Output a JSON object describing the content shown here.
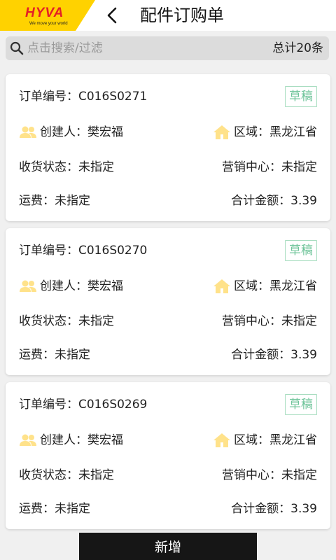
{
  "header": {
    "logo_text": "HYVA",
    "logo_tagline": "We move your world",
    "title": "配件订购单"
  },
  "search": {
    "placeholder": "点击搜索/过滤",
    "total": "总计20条"
  },
  "orders": [
    {
      "order_no_label": "订单编号：",
      "order_no": "C016S0271",
      "status_badge": "草稿",
      "creator_label": "创建人：",
      "creator": "樊宏福",
      "region_label": "区域：",
      "region": "黑龙江省",
      "receipt_label": "收货状态：",
      "receipt": "未指定",
      "center_label": "营销中心：",
      "center": "未指定",
      "freight_label": "运费：",
      "freight": "未指定",
      "amount_label": "合计金额：",
      "amount": "3.39"
    },
    {
      "order_no_label": "订单编号：",
      "order_no": "C016S0270",
      "status_badge": "草稿",
      "creator_label": "创建人：",
      "creator": "樊宏福",
      "region_label": "区域：",
      "region": "黑龙江省",
      "receipt_label": "收货状态：",
      "receipt": "未指定",
      "center_label": "营销中心：",
      "center": "未指定",
      "freight_label": "运费：",
      "freight": "未指定",
      "amount_label": "合计金额：",
      "amount": "3.39"
    },
    {
      "order_no_label": "订单编号：",
      "order_no": "C016S0269",
      "status_badge": "草稿",
      "creator_label": "创建人：",
      "creator": "樊宏福",
      "region_label": "区域：",
      "region": "黑龙江省",
      "receipt_label": "收货状态：",
      "receipt": "未指定",
      "center_label": "营销中心：",
      "center": "未指定",
      "freight_label": "运费：",
      "freight": "未指定",
      "amount_label": "合计金额：",
      "amount": "3.39"
    }
  ],
  "footer": {
    "add_button": "新增"
  },
  "colors": {
    "brand_yellow": "#ffd200",
    "brand_red": "#e41e26",
    "badge_green": "#6fc49a",
    "icon_yellow": "#ffe28a",
    "button_dark": "#161616"
  }
}
